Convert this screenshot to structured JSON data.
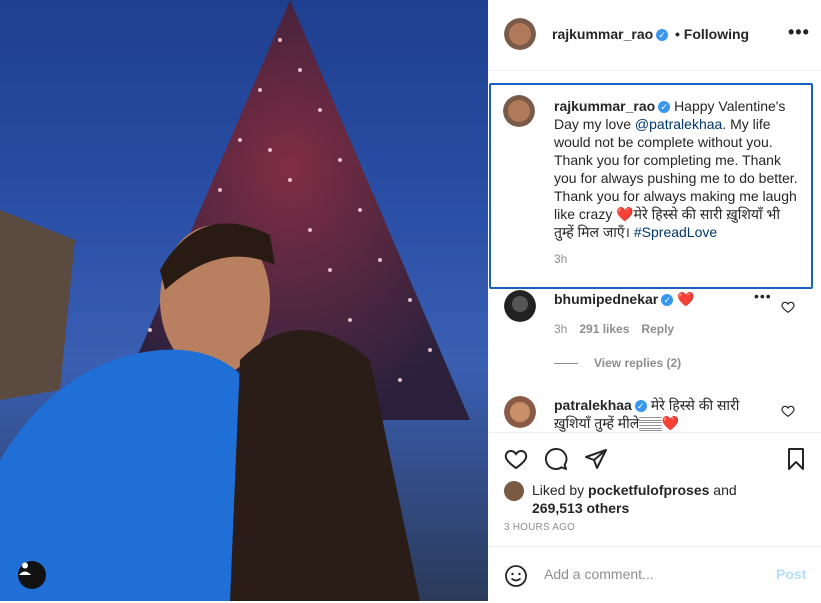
{
  "header": {
    "username": "rajkummar_rao",
    "following_label": "• Following",
    "more_label": "•••"
  },
  "caption": {
    "username": "rajkummar_rao",
    "text_before": "Happy Valentine's Day my love ",
    "mention": "@patralekhaa",
    "text_after": ". My life would not be complete without you. Thank you for completing me. Thank you for always pushing me to do better. Thank you for always making me laugh like crazy ❤️मेरे हिस्से की सारी ख़ुशियाँ भी तुम्हें मिल जाएँ। ",
    "hashtag": "#SpreadLove",
    "time": "3h"
  },
  "comments": [
    {
      "username": "bhumipednekar",
      "text": "❤️",
      "time": "3h",
      "likes": "291 likes",
      "reply_label": "Reply",
      "more": "•••",
      "view_replies": "View replies (2)"
    },
    {
      "username": "patralekhaa",
      "text": "मेरे हिस्से की सारी ख़ुशियाँ तुम्हें मीले𝄛𝄛❤️"
    }
  ],
  "likes": {
    "prefix": "Liked by ",
    "by": "pocketfulofproses",
    "suffix": " and",
    "others": "269,513 others"
  },
  "timestamp": "3 HOURS AGO",
  "comment_box": {
    "placeholder": "Add a comment...",
    "post_label": "Post"
  },
  "colors": {
    "verified": "#3897f0",
    "focus_outline": "#1a5fc4",
    "post_disabled": "#b2dffc",
    "like_red": "#ed4956"
  }
}
